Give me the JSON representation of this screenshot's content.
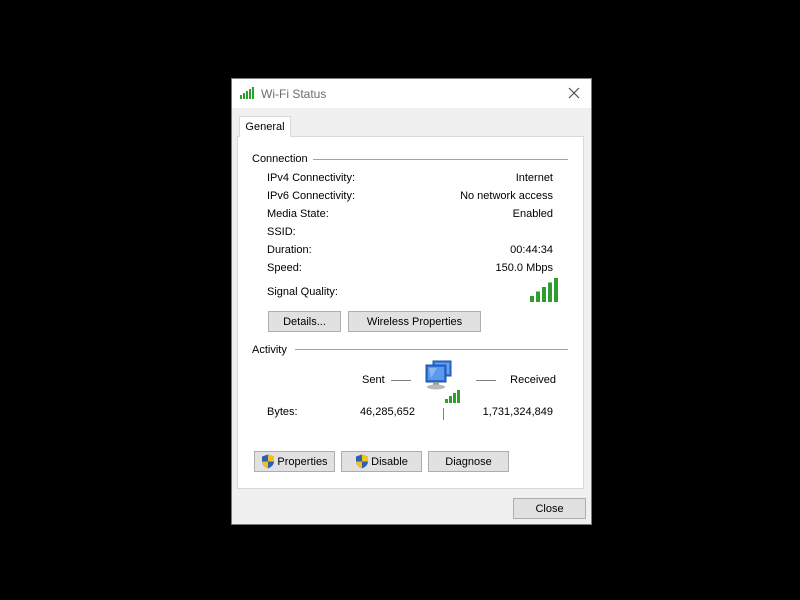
{
  "window": {
    "title": "Wi-Fi Status"
  },
  "tabs": [
    {
      "label": "General"
    }
  ],
  "connection": {
    "group_label": "Connection",
    "rows": [
      {
        "label": "IPv4 Connectivity:",
        "value": "Internet"
      },
      {
        "label": "IPv6 Connectivity:",
        "value": "No network access"
      },
      {
        "label": "Media State:",
        "value": "Enabled"
      },
      {
        "label": "SSID:",
        "value": ""
      },
      {
        "label": "Duration:",
        "value": "00:44:34"
      },
      {
        "label": "Speed:",
        "value": "150.0 Mbps"
      }
    ],
    "signal_label": "Signal Quality:",
    "signal_bars_lit": 5,
    "signal_bars_total": 5,
    "details_button": "Details...",
    "wireless_properties_button": "Wireless Properties"
  },
  "activity": {
    "group_label": "Activity",
    "sent_label": "Sent",
    "received_label": "Received",
    "bytes_label": "Bytes:",
    "bytes_sent": "46,285,652",
    "bytes_received": "1,731,324,849"
  },
  "buttons": {
    "properties": "Properties",
    "disable": "Disable",
    "diagnose": "Diagnose",
    "close": "Close"
  },
  "colors": {
    "signal_green": "#2e9e2e",
    "network_blue": "#2a6fd6",
    "shield_blue": "#2d5fb3",
    "shield_yellow": "#f2c21b"
  },
  "icons": {
    "title": "wifi-signal-icon",
    "close": "close-icon",
    "network": "network-computers-icon",
    "shield": "uac-shield-icon"
  }
}
